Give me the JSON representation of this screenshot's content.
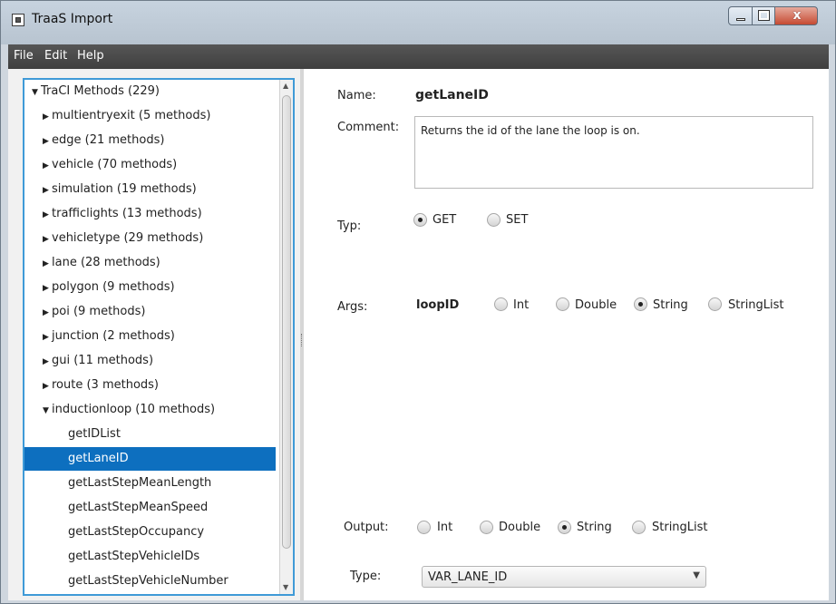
{
  "window": {
    "title": "TraaS Import",
    "minimize_icon": "minimize-icon",
    "maximize_icon": "maximize-icon",
    "close_glyph": "x"
  },
  "menu": [
    {
      "label": "File"
    },
    {
      "label": "Edit"
    },
    {
      "label": "Help"
    }
  ],
  "tree": {
    "root": "TraCI Methods (229)",
    "groups": [
      "multientryexit (5 methods)",
      "edge (21 methods)",
      "vehicle (70 methods)",
      "simulation (19 methods)",
      "trafficlights (13 methods)",
      "vehicletype (29 methods)",
      "lane (28 methods)",
      "polygon (9 methods)",
      "poi (9 methods)",
      "junction (2 methods)",
      "gui (11 methods)",
      "route (3 methods)"
    ],
    "expanded_group": "inductionloop (10 methods)",
    "methods": [
      "getIDList",
      "getLaneID",
      "getLastStepMeanLength",
      "getLastStepMeanSpeed",
      "getLastStepOccupancy",
      "getLastStepVehicleIDs",
      "getLastStepVehicleNumber"
    ],
    "selected": "getLaneID"
  },
  "detail": {
    "name_label": "Name:",
    "name_value": "getLaneID",
    "comment_label": "Comment:",
    "comment_value": "Returns the id of the lane the loop is on.",
    "typ_label": "Typ:",
    "typ_options": [
      "GET",
      "SET"
    ],
    "typ_selected": "GET",
    "args_label": "Args:",
    "arg_name": "loopID",
    "arg_options": [
      "Int",
      "Double",
      "String",
      "StringList"
    ],
    "arg_selected": "String",
    "output_label": "Output:",
    "output_options": [
      "Int",
      "Double",
      "String",
      "StringList"
    ],
    "output_selected": "String",
    "type_label": "Type:",
    "type_value": "VAR_LANE_ID"
  },
  "colors": {
    "selection": "#0d6fbf",
    "focus_border": "#3f9ad7",
    "menubar": "#4a4a4a"
  }
}
